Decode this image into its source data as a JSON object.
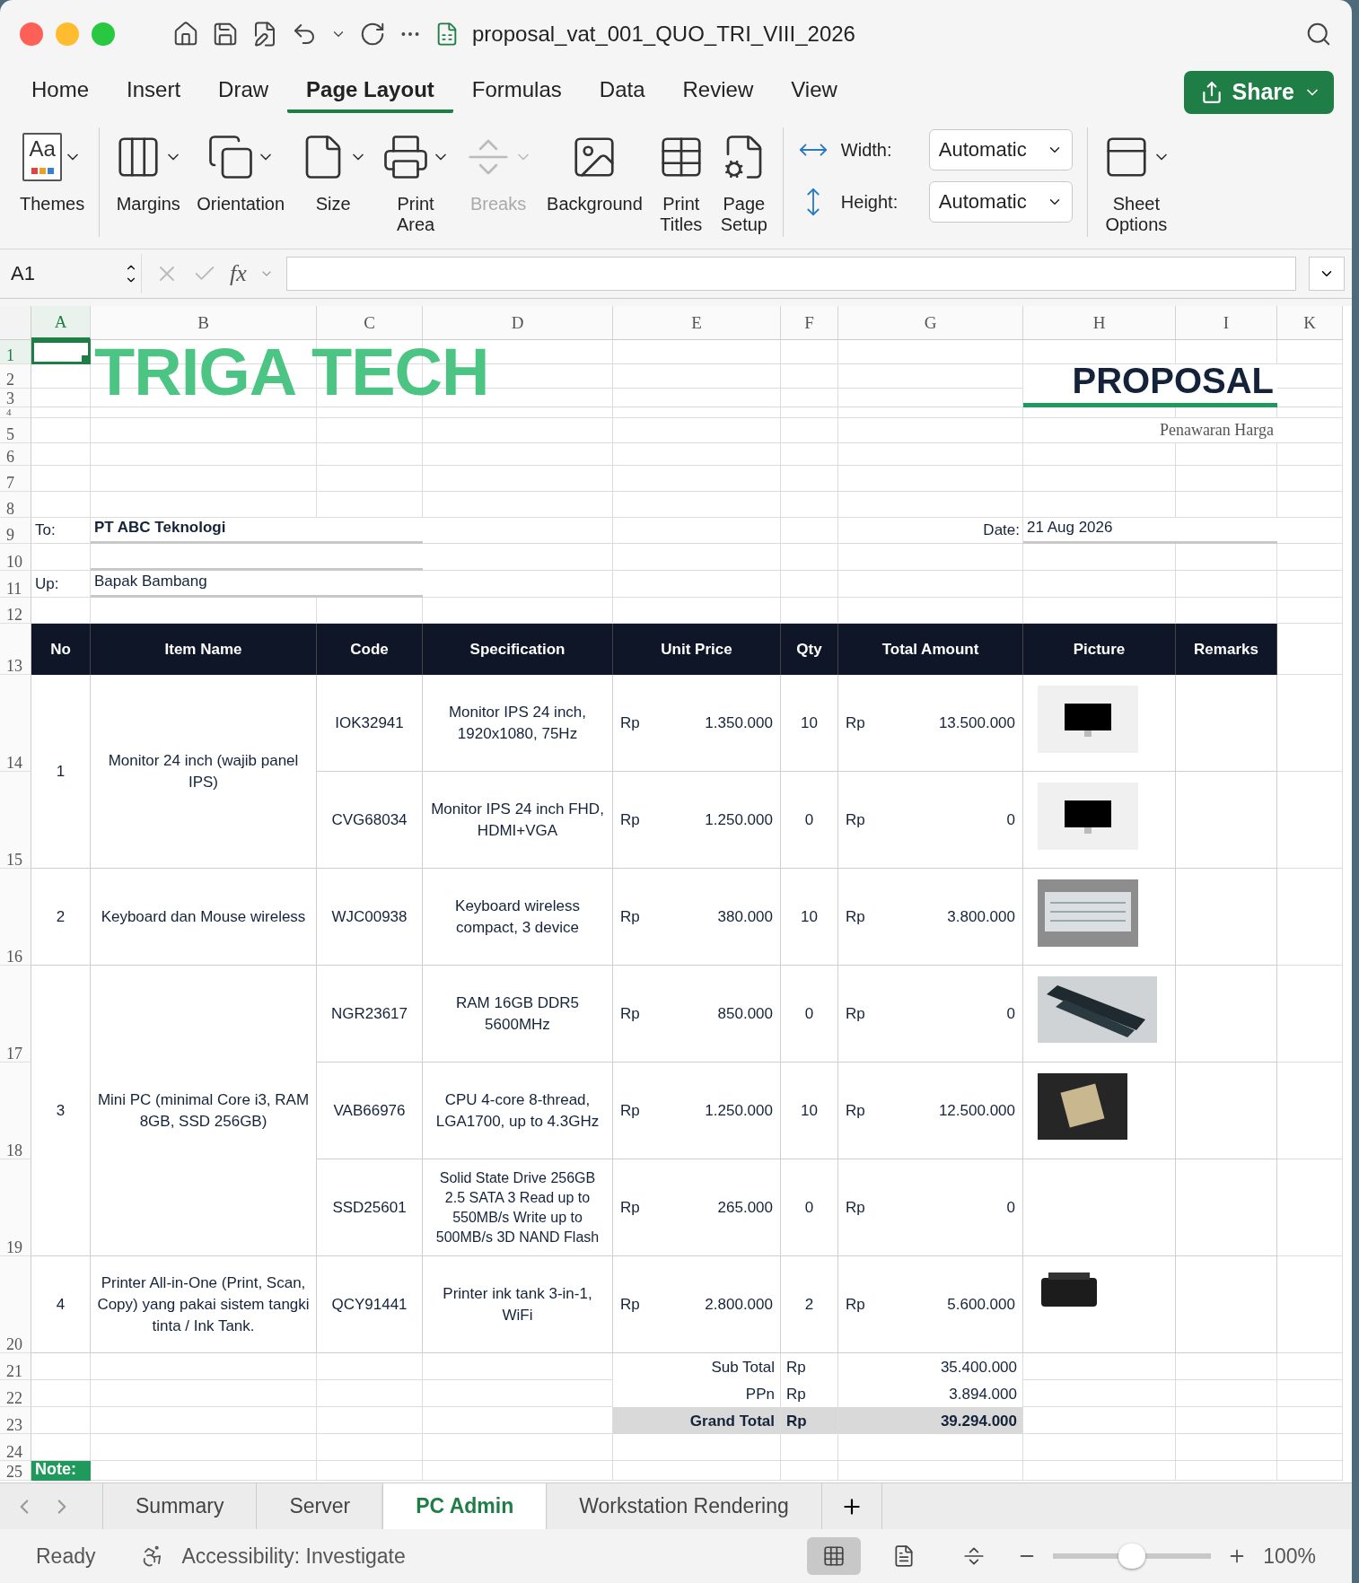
{
  "window": {
    "title": "proposal_vat_001_QUO_TRI_VIII_2026"
  },
  "menu_tabs": [
    {
      "label": "Home",
      "selected": false
    },
    {
      "label": "Insert",
      "selected": false
    },
    {
      "label": "Draw",
      "selected": false
    },
    {
      "label": "Page Layout",
      "selected": true
    },
    {
      "label": "Formulas",
      "selected": false
    },
    {
      "label": "Data",
      "selected": false
    },
    {
      "label": "Review",
      "selected": false
    },
    {
      "label": "View",
      "selected": false
    }
  ],
  "share_button": {
    "label": "Share"
  },
  "ribbon": [
    {
      "kind": "buttons",
      "items": [
        {
          "kind": "themes",
          "label": "Themes",
          "icon_text": "Aa",
          "dropdown": true,
          "disabled": false
        }
      ]
    },
    {
      "kind": "buttons",
      "items": [
        {
          "kind": "margins",
          "label": "Margins",
          "dropdown": true,
          "disabled": false
        },
        {
          "kind": "orientation",
          "label": "Orientation",
          "dropdown": true,
          "disabled": false
        },
        {
          "kind": "size",
          "label": "Size",
          "dropdown": true,
          "disabled": false
        },
        {
          "kind": "print_area",
          "label": "Print Area",
          "dropdown": true,
          "disabled": false
        },
        {
          "kind": "breaks",
          "label": "Breaks",
          "dropdown": true,
          "disabled": true
        },
        {
          "kind": "background",
          "label": "Background",
          "dropdown": false,
          "disabled": false
        },
        {
          "kind": "print_titles",
          "label": "Print Titles",
          "dropdown": false,
          "disabled": false
        },
        {
          "kind": "page_setup",
          "label": "Page Setup",
          "dropdown": false,
          "disabled": false
        }
      ]
    },
    {
      "kind": "scale",
      "fields": [
        {
          "kind": "width",
          "label": "Width:",
          "value": "Automatic"
        },
        {
          "kind": "height",
          "label": "Height:",
          "value": "Automatic"
        }
      ]
    },
    {
      "kind": "buttons",
      "items": [
        {
          "kind": "sheet_options",
          "label": "Sheet Options",
          "dropdown": true,
          "disabled": false
        }
      ]
    }
  ],
  "formula_bar": {
    "name_box": "A1",
    "function_label": "fx"
  },
  "columns": [
    {
      "label": "A",
      "selected": true
    },
    {
      "label": "B",
      "selected": false
    },
    {
      "label": "C",
      "selected": false
    },
    {
      "label": "D",
      "selected": false
    },
    {
      "label": "E",
      "selected": false
    },
    {
      "label": "F",
      "selected": false
    },
    {
      "label": "G",
      "selected": false
    },
    {
      "label": "H",
      "selected": false
    },
    {
      "label": "I",
      "selected": false
    },
    {
      "label": "K",
      "selected": false
    }
  ],
  "rows": [
    {
      "label": "1",
      "selected": true
    },
    {
      "label": "2",
      "selected": false
    },
    {
      "label": "3",
      "selected": false
    },
    {
      "label": "4",
      "selected": false
    },
    {
      "label": "5",
      "selected": false
    },
    {
      "label": "6",
      "selected": false
    },
    {
      "label": "7",
      "selected": false
    },
    {
      "label": "8",
      "selected": false
    },
    {
      "label": "9",
      "selected": false
    },
    {
      "label": "10",
      "selected": false
    },
    {
      "label": "11",
      "selected": false
    },
    {
      "label": "12",
      "selected": false
    },
    {
      "label": "13",
      "selected": false
    },
    {
      "label": "14",
      "selected": false
    },
    {
      "label": "15",
      "selected": false
    },
    {
      "label": "16",
      "selected": false
    },
    {
      "label": "17",
      "selected": false
    },
    {
      "label": "18",
      "selected": false
    },
    {
      "label": "19",
      "selected": false
    },
    {
      "label": "20",
      "selected": false
    },
    {
      "label": "21",
      "selected": false
    },
    {
      "label": "22",
      "selected": false
    },
    {
      "label": "23",
      "selected": false
    },
    {
      "label": "24",
      "selected": false
    },
    {
      "label": "25",
      "selected": false
    }
  ],
  "header": {
    "logo": "TRIGA TECH",
    "title": "PROPOSAL",
    "subtitle": "Penawaran Harga"
  },
  "recipient": {
    "to_label": "To:",
    "to_value": "PT ABC Teknologi",
    "up_label": "Up:",
    "up_value": "Bapak Bambang",
    "date_label": "Date:",
    "date_value": "21 Aug 2026"
  },
  "table": {
    "columns": [
      "No",
      "Item Name",
      "Code",
      "Specification",
      "Unit Price",
      "Qty",
      "Total Amount",
      "Picture",
      "Remarks"
    ],
    "items": [
      {
        "no": "1",
        "name": "Monitor 24 inch (wajib panel IPS)",
        "lines": [
          {
            "code": "IOK32941",
            "spec": "Monitor IPS 24 inch, 1920x1080, 75Hz",
            "currency": "Rp",
            "unit_price": "1.350.000",
            "qty": "10",
            "total_currency": "Rp",
            "total": "13.500.000",
            "picture": {
              "kind": "monitor"
            }
          },
          {
            "code": "CVG68034",
            "spec": "Monitor IPS 24 inch FHD, HDMI+VGA",
            "currency": "Rp",
            "unit_price": "1.250.000",
            "qty": "0",
            "total_currency": "Rp",
            "total": "0",
            "picture": {
              "kind": "monitor"
            }
          }
        ]
      },
      {
        "no": "2",
        "name": "Keyboard dan Mouse wireless",
        "lines": [
          {
            "code": "WJC00938",
            "spec": "Keyboard wireless compact, 3 device",
            "currency": "Rp",
            "unit_price": "380.000",
            "qty": "10",
            "total_currency": "Rp",
            "total": "3.800.000",
            "picture": {
              "kind": "keyboard"
            }
          }
        ]
      },
      {
        "no": "3",
        "name": "Mini PC (minimal Core i3, RAM 8GB, SSD 256GB)",
        "lines": [
          {
            "code": "NGR23617",
            "spec": "RAM 16GB DDR5 5600MHz",
            "currency": "Rp",
            "unit_price": "850.000",
            "qty": "0",
            "total_currency": "Rp",
            "total": "0",
            "picture": {
              "kind": "ram"
            }
          },
          {
            "code": "VAB66976",
            "spec": "CPU 4-core 8-thread, LGA1700, up to 4.3GHz",
            "currency": "Rp",
            "unit_price": "1.250.000",
            "qty": "10",
            "total_currency": "Rp",
            "total": "12.500.000",
            "picture": {
              "kind": "cpu"
            }
          },
          {
            "code": "SSD25601",
            "spec": "Solid State Drive 256GB 2.5 SATA 3 Read up to 550MB/s Write up to 500MB/s 3D NAND Flash",
            "currency": "Rp",
            "unit_price": "265.000",
            "qty": "0",
            "total_currency": "Rp",
            "total": "0"
          }
        ]
      },
      {
        "no": "4",
        "name": "Printer All-in-One (Print, Scan, Copy) yang pakai sistem tangki tinta / Ink Tank.",
        "lines": [
          {
            "code": "QCY91441",
            "spec": "Printer ink tank 3-in-1, WiFi",
            "currency": "Rp",
            "unit_price": "2.800.000",
            "qty": "2",
            "total_currency": "Rp",
            "total": "5.600.000",
            "picture": {
              "kind": "printer"
            }
          }
        ]
      }
    ]
  },
  "totals": [
    {
      "kind": "sub",
      "label": "Sub Total",
      "currency": "Rp",
      "value": "35.400.000"
    },
    {
      "kind": "sub",
      "label": "PPn",
      "currency": "Rp",
      "value": "3.894.000"
    },
    {
      "kind": "grand",
      "label": "Grand Total",
      "currency": "Rp",
      "value": "39.294.000"
    }
  ],
  "note": "Note:",
  "sheet_tabs": [
    {
      "label": "Summary",
      "selected": false
    },
    {
      "label": "Server",
      "selected": false
    },
    {
      "label": "PC Admin",
      "selected": true
    },
    {
      "label": "Workstation Rendering",
      "selected": false
    }
  ],
  "status_bar": {
    "status": "Ready",
    "accessibility": "Accessibility: Investigate",
    "views": [
      {
        "kind": "normal",
        "selected": true
      },
      {
        "kind": "page_layout",
        "selected": false
      },
      {
        "kind": "page_break",
        "selected": false
      }
    ],
    "zoom": {
      "level": 0.5,
      "reading": "100%"
    }
  }
}
